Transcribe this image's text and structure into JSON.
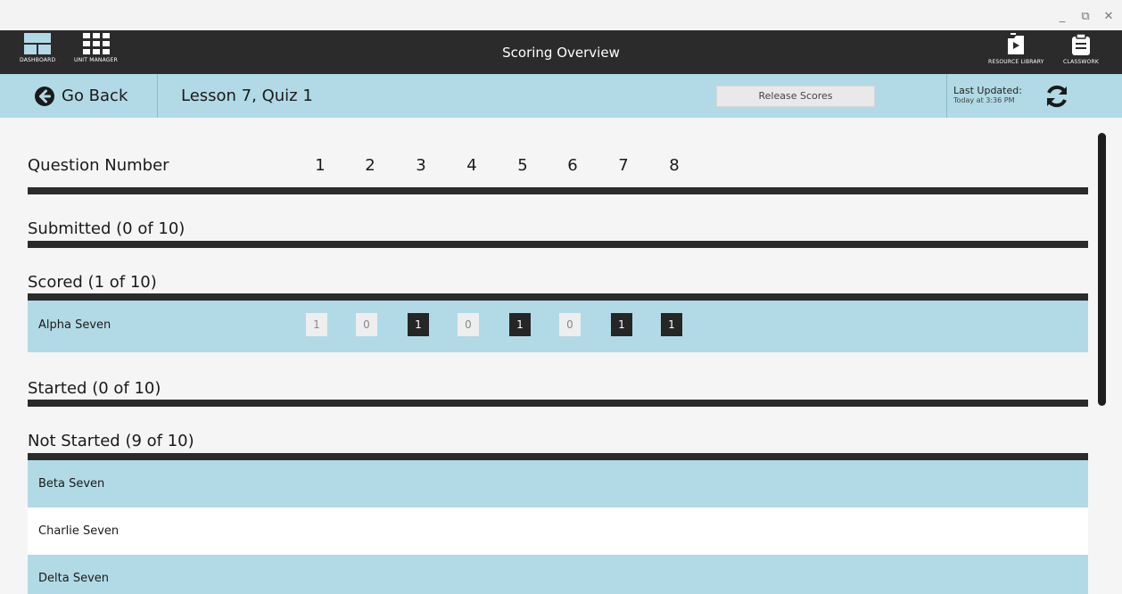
{
  "window": {
    "controls": {
      "minimize": "_",
      "restore": "⧉",
      "close": "✕"
    }
  },
  "appbar": {
    "title": "Scoring Overview",
    "left_buttons": [
      {
        "label": "DASHBOARD",
        "icon": "dashboard-icon"
      },
      {
        "label": "UNIT MANAGER",
        "icon": "grid-icon"
      }
    ],
    "right_buttons": [
      {
        "label": "RESOURCE LIBRARY",
        "icon": "resource-library-icon"
      },
      {
        "label": "CLASSWORK",
        "icon": "classwork-icon"
      }
    ]
  },
  "subbar": {
    "back_label": "Go Back",
    "lesson_title": "Lesson 7, Quiz 1",
    "release_label": "Release Scores",
    "updated_label": "Last Updated:",
    "updated_time": "Today at 3:36 PM"
  },
  "table": {
    "header_label": "Question Number",
    "questions": [
      "1",
      "2",
      "3",
      "4",
      "5",
      "6",
      "7",
      "8"
    ],
    "sections": {
      "submitted": "Submitted (0 of 10)",
      "scored": "Scored (1 of 10)",
      "started": "Started (0 of 10)",
      "not_started": "Not Started (9 of 10)"
    },
    "scored_students": [
      {
        "name": "Alpha Seven",
        "scores": [
          "1",
          "0",
          "1",
          "0",
          "1",
          "0",
          "1",
          "1"
        ],
        "dark": [
          false,
          false,
          true,
          false,
          true,
          false,
          true,
          true
        ]
      }
    ],
    "not_started_students": [
      "Beta Seven",
      "Charlie Seven",
      "Delta Seven"
    ]
  },
  "colors": {
    "appbar": "#2b2b2b",
    "subbar": "#b1dae6",
    "row_highlight": "#b1dae6",
    "dashboard_icon": "#b1dae6"
  }
}
